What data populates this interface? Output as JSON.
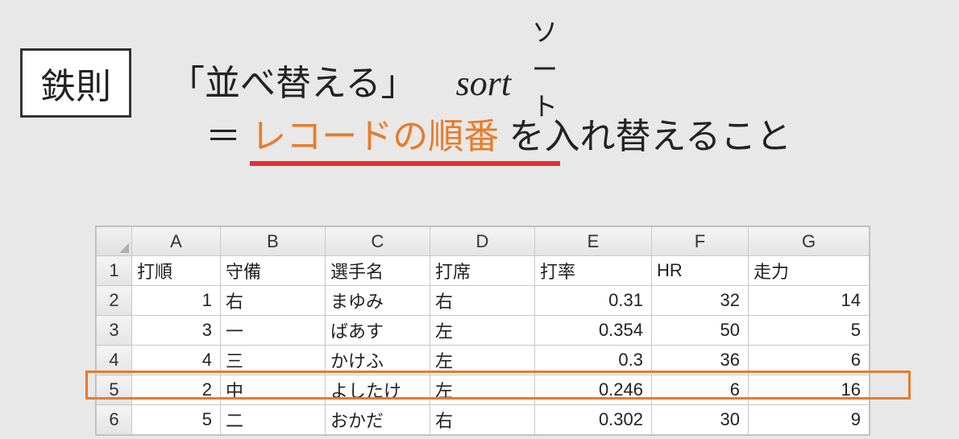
{
  "labels": {
    "rule_box": "鉄則",
    "ruby": "ソート",
    "main_bracket": "「並べ替える」",
    "main_sort": "sort",
    "def_prefix": "＝",
    "def_highlight": "レコードの順番",
    "def_suffix": "を入れ替えること"
  },
  "sheet": {
    "col_labels": [
      "A",
      "B",
      "C",
      "D",
      "E",
      "F",
      "G"
    ],
    "row_labels": [
      "1",
      "2",
      "3",
      "4",
      "5",
      "6"
    ],
    "headers": [
      "打順",
      "守備",
      "選手名",
      "打席",
      "打率",
      "HR",
      "走力"
    ],
    "rows": [
      {
        "a": "1",
        "b": "右",
        "c": "まゆみ",
        "d": "右",
        "e": "0.31",
        "f": "32",
        "g": "14"
      },
      {
        "a": "3",
        "b": "一",
        "c": "ばあす",
        "d": "左",
        "e": "0.354",
        "f": "50",
        "g": "5"
      },
      {
        "a": "4",
        "b": "三",
        "c": "かけふ",
        "d": "左",
        "e": "0.3",
        "f": "36",
        "g": "6"
      },
      {
        "a": "2",
        "b": "中",
        "c": "よしたけ",
        "d": "左",
        "e": "0.246",
        "f": "6",
        "g": "16"
      },
      {
        "a": "5",
        "b": "二",
        "c": "おかだ",
        "d": "右",
        "e": "0.302",
        "f": "30",
        "g": "9"
      }
    ],
    "highlight_row_index": 3
  },
  "chart_data": {
    "type": "table",
    "title": "",
    "columns": [
      "打順",
      "守備",
      "選手名",
      "打席",
      "打率",
      "HR",
      "走力"
    ],
    "rows": [
      [
        1,
        "右",
        "まゆみ",
        "右",
        0.31,
        32,
        14
      ],
      [
        3,
        "一",
        "ばあす",
        "左",
        0.354,
        50,
        5
      ],
      [
        4,
        "三",
        "かけふ",
        "左",
        0.3,
        36,
        6
      ],
      [
        2,
        "中",
        "よしたけ",
        "左",
        0.246,
        6,
        16
      ],
      [
        5,
        "二",
        "おかだ",
        "右",
        0.302,
        30,
        9
      ]
    ]
  }
}
